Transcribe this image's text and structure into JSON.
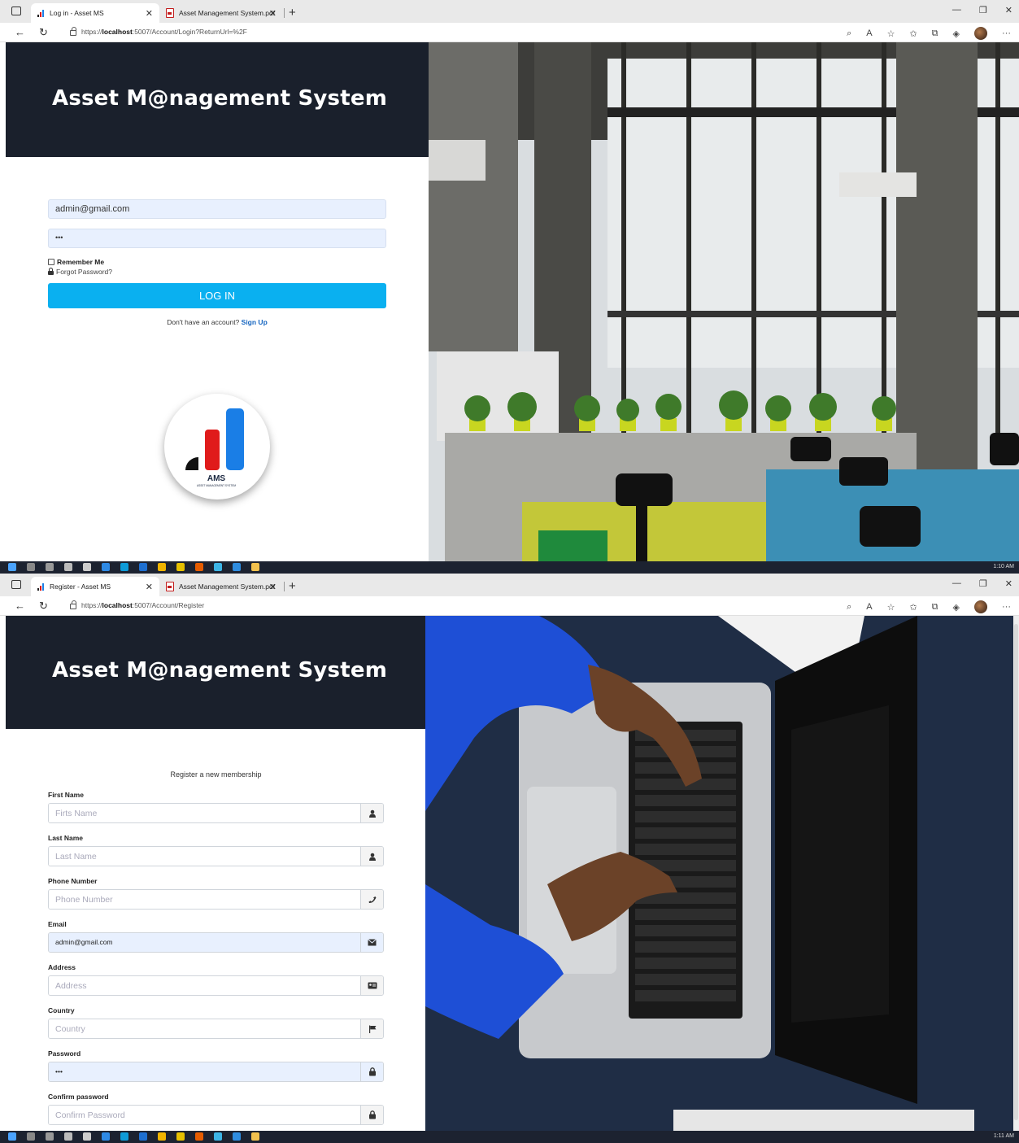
{
  "login_screen": {
    "tabs": [
      {
        "title": "Log in - Asset MS",
        "icon": "signal-bars-icon"
      },
      {
        "title": "Asset Management System.pdf",
        "icon": "pdf-icon"
      }
    ],
    "url": {
      "prefix": "https://",
      "host": "localhost",
      "rest": ":5007/Account/Login?ReturnUrl=%2F"
    },
    "header_title": "Asset M@nagement System",
    "email_value": "admin@gmail.com",
    "password_value": "•••",
    "remember_label": "Remember Me",
    "forgot_label": "Forgot Password?",
    "login_button": "LOG IN",
    "signup_prompt": "Don't have an account?",
    "signup_link": "Sign Up",
    "logo_text": "AMS",
    "logo_subtext": "ASSET MANAGEMENT SYSTEM",
    "clock": "1:10 AM"
  },
  "register_screen": {
    "tabs": [
      {
        "title": "Register - Asset MS",
        "icon": "signal-bars-icon"
      },
      {
        "title": "Asset Management System.pdf",
        "icon": "pdf-icon"
      }
    ],
    "url": {
      "prefix": "https://",
      "host": "localhost",
      "rest": ":5007/Account/Register"
    },
    "header_title": "Asset M@nagement System",
    "form_title": "Register a new membership",
    "fields": [
      {
        "label": "First Name",
        "placeholder": "Firts Name",
        "value": "",
        "icon": "user-icon"
      },
      {
        "label": "Last Name",
        "placeholder": "Last Name",
        "value": "",
        "icon": "user-icon"
      },
      {
        "label": "Phone Number",
        "placeholder": "Phone Number",
        "value": "",
        "icon": "phone-icon"
      },
      {
        "label": "Email",
        "placeholder": "",
        "value": "admin@gmail.com",
        "icon": "envelope-icon"
      },
      {
        "label": "Address",
        "placeholder": "Address",
        "value": "",
        "icon": "address-card-icon"
      },
      {
        "label": "Country",
        "placeholder": "Country",
        "value": "",
        "icon": "flag-icon"
      },
      {
        "label": "Password",
        "placeholder": "",
        "value": "•••",
        "icon": "lock-icon"
      },
      {
        "label": "Confirm password",
        "placeholder": "Confirm Password",
        "value": "",
        "icon": "lock-icon"
      }
    ],
    "clock": "1:11 AM"
  },
  "colors": {
    "header_bg": "#1a202c",
    "login_button": "#0ab0f0",
    "autofill_bg": "#e8f0fe",
    "signup_link": "#1565c0",
    "logo_red": "#e01b1b",
    "logo_blue": "#1a7ee6"
  }
}
